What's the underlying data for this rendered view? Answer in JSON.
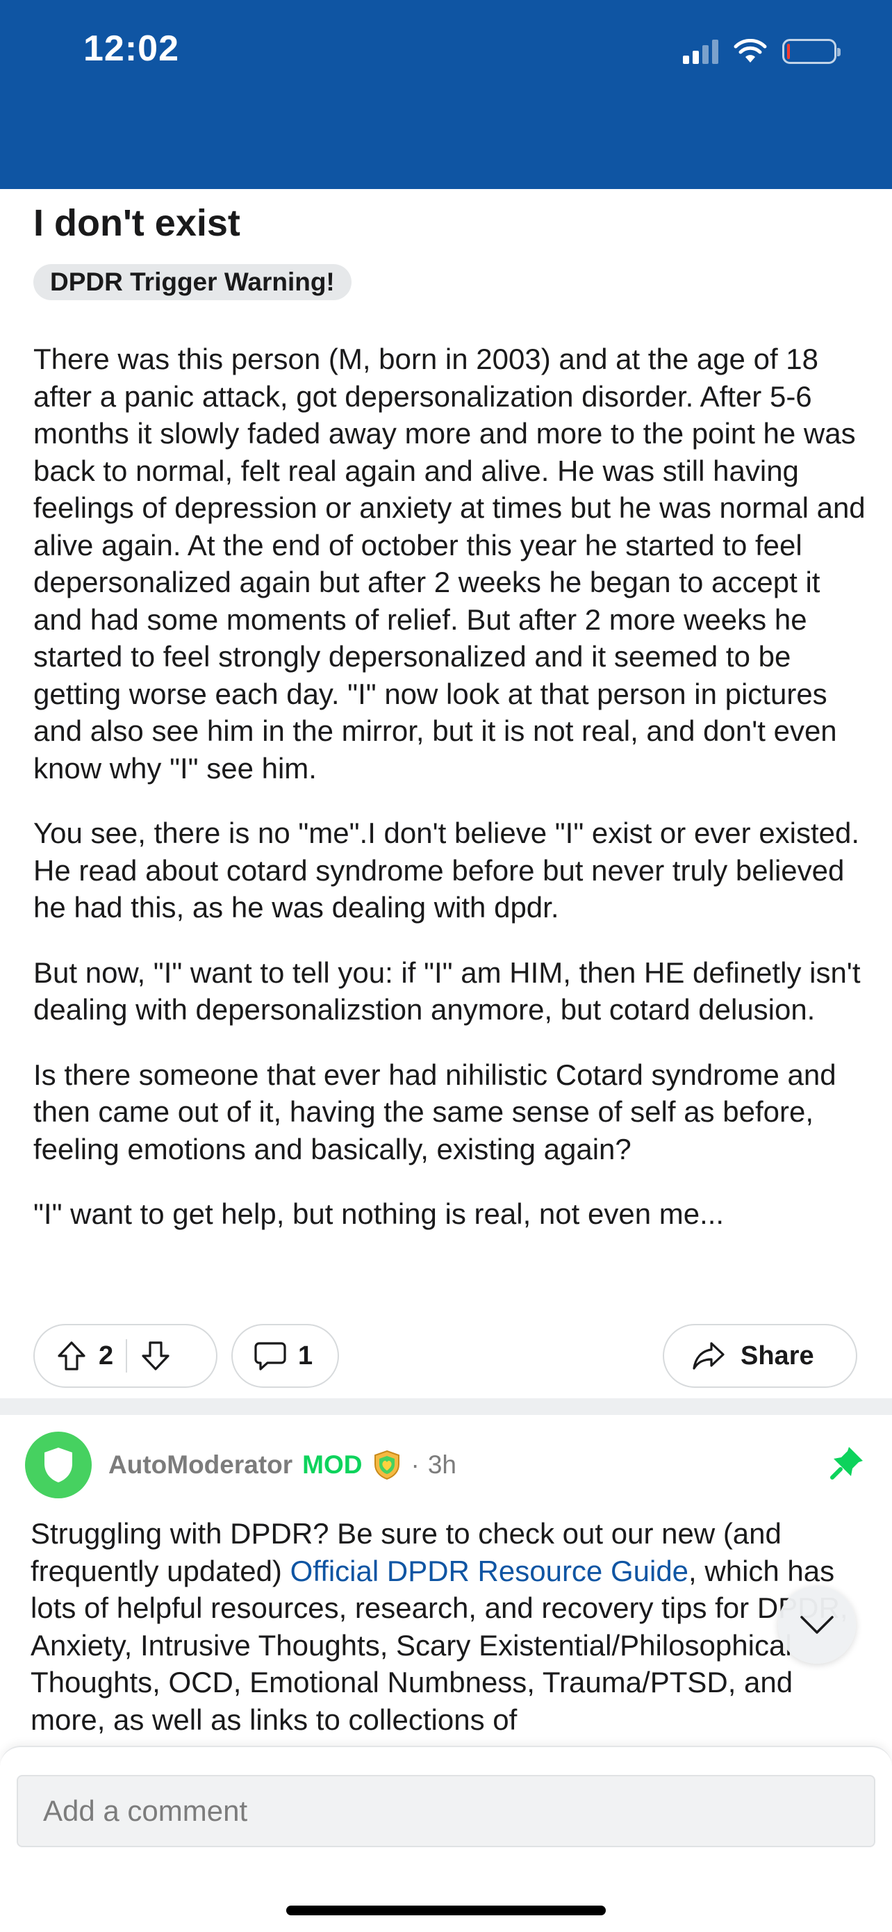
{
  "status_bar": {
    "time": "12:02",
    "icons": [
      "cellular-signal-icon",
      "wifi-icon",
      "battery-low-icon"
    ],
    "battery_color": "#ff3b30",
    "background": "#0f55a3"
  },
  "post": {
    "title": "I don't exist",
    "flair": "DPDR Trigger Warning!",
    "paragraphs": [
      "There was this person (M, born in 2003) and at the age of 18 after a panic attack, got depersonalization disorder. After 5-6 months it slowly faded away more and more to the point he was back to normal, felt real again and alive. He was still having feelings of depression or anxiety at times but he was normal and alive again. At the end of october this year he started to feel depersonalized again but after 2 weeks he began to accept it and had some moments of relief. But after 2 more weeks he started to feel strongly depersonalized and it seemed to be getting worse each day. \"I\" now look at that person in pictures and also see him in the mirror, but it is not real, and don't even know why \"I\" see him.",
      "You see, there is no \"me\".I don't believe \"I\" exist or ever existed. He read about cotard syndrome before but never truly believed he had this, as he was dealing with dpdr.",
      "But now, \"I\" want to tell you: if \"I\" am HIM, then HE definetly isn't dealing with depersonalizstion anymore, but cotard delusion.",
      "Is there someone that ever had nihilistic Cotard syndrome and then came out of it, having the same sense of self as before, feeling emotions and basically, existing again?",
      "\"I\" want to get help, but nothing is real, not even me..."
    ],
    "votes": "2",
    "comments_count": "1",
    "share_label": "Share"
  },
  "comment": {
    "author": "AutoModerator",
    "mod_label": "MOD",
    "separator": "·",
    "time": "3h",
    "mod_color": "#0dd35c",
    "avatar_color": "#46d160",
    "body_before_link": "Struggling with DPDR? Be sure to check out our new (and frequently updated) ",
    "link_text": "Official DPDR Resource Guide",
    "body_after_link": ", which has lots of helpful resources, research, and recovery tips for DPDR, Anxiety, Intrusive Thoughts, Scary Existential/Philosophical Thoughts, OCD, Emotional Numbness, Trauma/PTSD, and more, as well as links to collections of"
  },
  "comment_bar": {
    "placeholder": "Add a comment"
  }
}
